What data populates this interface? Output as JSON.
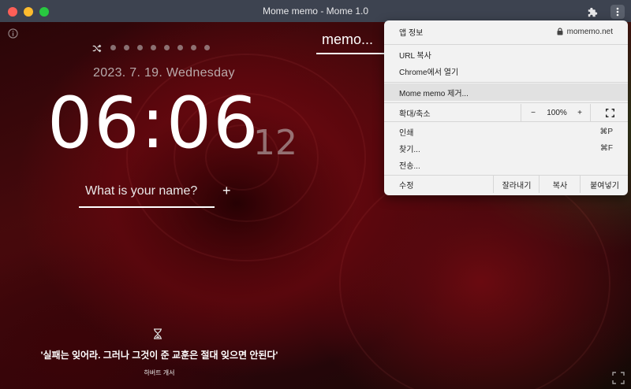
{
  "window": {
    "title": "Mome memo - Mome 1.0"
  },
  "app": {
    "date": "2023. 7. 19. Wednesday",
    "clock": {
      "time": "06:06",
      "seconds": "12"
    },
    "name_placeholder": "What is your name?",
    "add_label": "+",
    "memo_label": "memo...",
    "quote": "'실패는 잊어라. 그러나 그것이 준 교훈은 절대 잊으면 안된다'",
    "quote_author": "하버트 개서",
    "page_dots": 8
  },
  "menu": {
    "app_info": "앱 정보",
    "domain": "momemo.net",
    "copy_url": "URL 복사",
    "open_in_chrome": "Chrome에서 열기",
    "remove_app": "Mome memo 제거...",
    "zoom_label": "확대/축소",
    "zoom_minus": "−",
    "zoom_value": "100%",
    "zoom_plus": "+",
    "print": "인쇄",
    "print_shortcut": "⌘P",
    "find": "찾기...",
    "find_shortcut": "⌘F",
    "send": "전송...",
    "edit_label": "수정",
    "cut": "잘라내기",
    "copy": "복사",
    "paste": "붙여넣기"
  },
  "icons": {
    "extensions": "puzzle-icon",
    "more": "more-vertical-icon",
    "info": "info-icon",
    "shuffle": "shuffle-icon",
    "hourglass": "hourglass-icon",
    "fullscreen": "fullscreen-icon",
    "lock": "lock-icon"
  }
}
